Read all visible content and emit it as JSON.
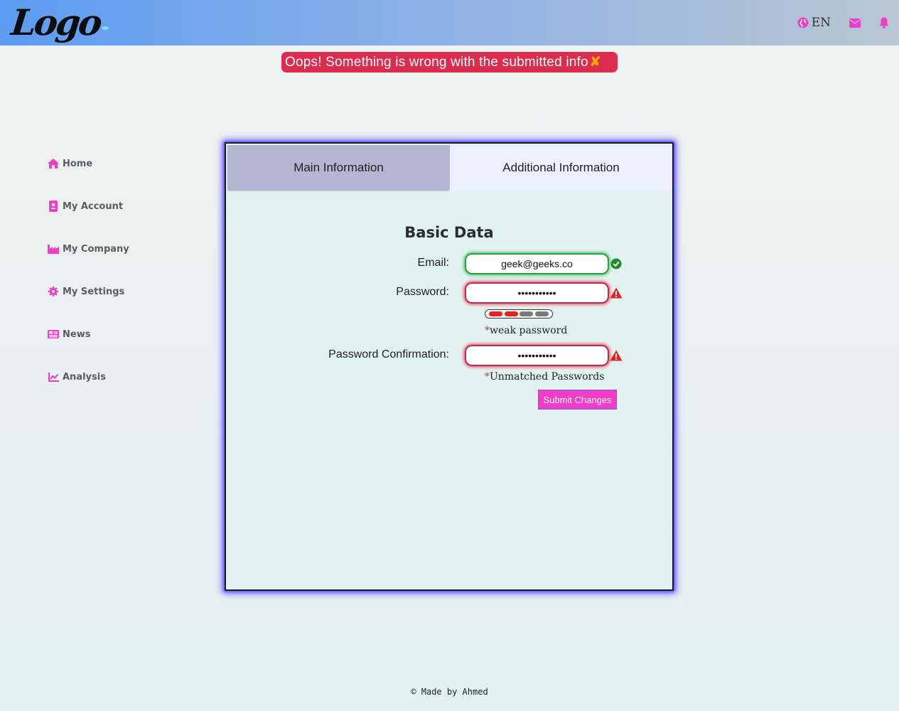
{
  "header": {
    "logo_text": "Logo",
    "language": "EN",
    "icons": [
      "globe-icon",
      "mail-icon",
      "bell-icon"
    ],
    "accent_color": "#f03cc6"
  },
  "alert": {
    "message": "Oops! Something is wrong with the submitted info",
    "close_label": "✘",
    "color": "#dc2d4e"
  },
  "sidebar": {
    "items": [
      {
        "label": "Home",
        "icon": "home-icon"
      },
      {
        "label": "My Account",
        "icon": "address-book-icon"
      },
      {
        "label": "My Company",
        "icon": "industry-icon"
      },
      {
        "label": "My Settings",
        "icon": "gear-icon"
      },
      {
        "label": "News",
        "icon": "newspaper-icon"
      },
      {
        "label": "Analysis",
        "icon": "chart-line-icon"
      }
    ]
  },
  "tabs": [
    {
      "label": "Main Information"
    },
    {
      "label": "Additional Information"
    }
  ],
  "form": {
    "title": "Basic Data",
    "email_label": "Email:",
    "email_value": "geek@geeks.co",
    "password_label": "Password:",
    "password_value": "•••••••••••",
    "strength_level": 0.5,
    "password_error": "weak password",
    "confirm_label": "Password Confirmation:",
    "confirm_value": "•••••••••••",
    "confirm_error": "Unmatched Passwords",
    "error_star": "*",
    "submit_label": "Submit Changes"
  },
  "footer": {
    "text": "© Made by Ahmed"
  }
}
